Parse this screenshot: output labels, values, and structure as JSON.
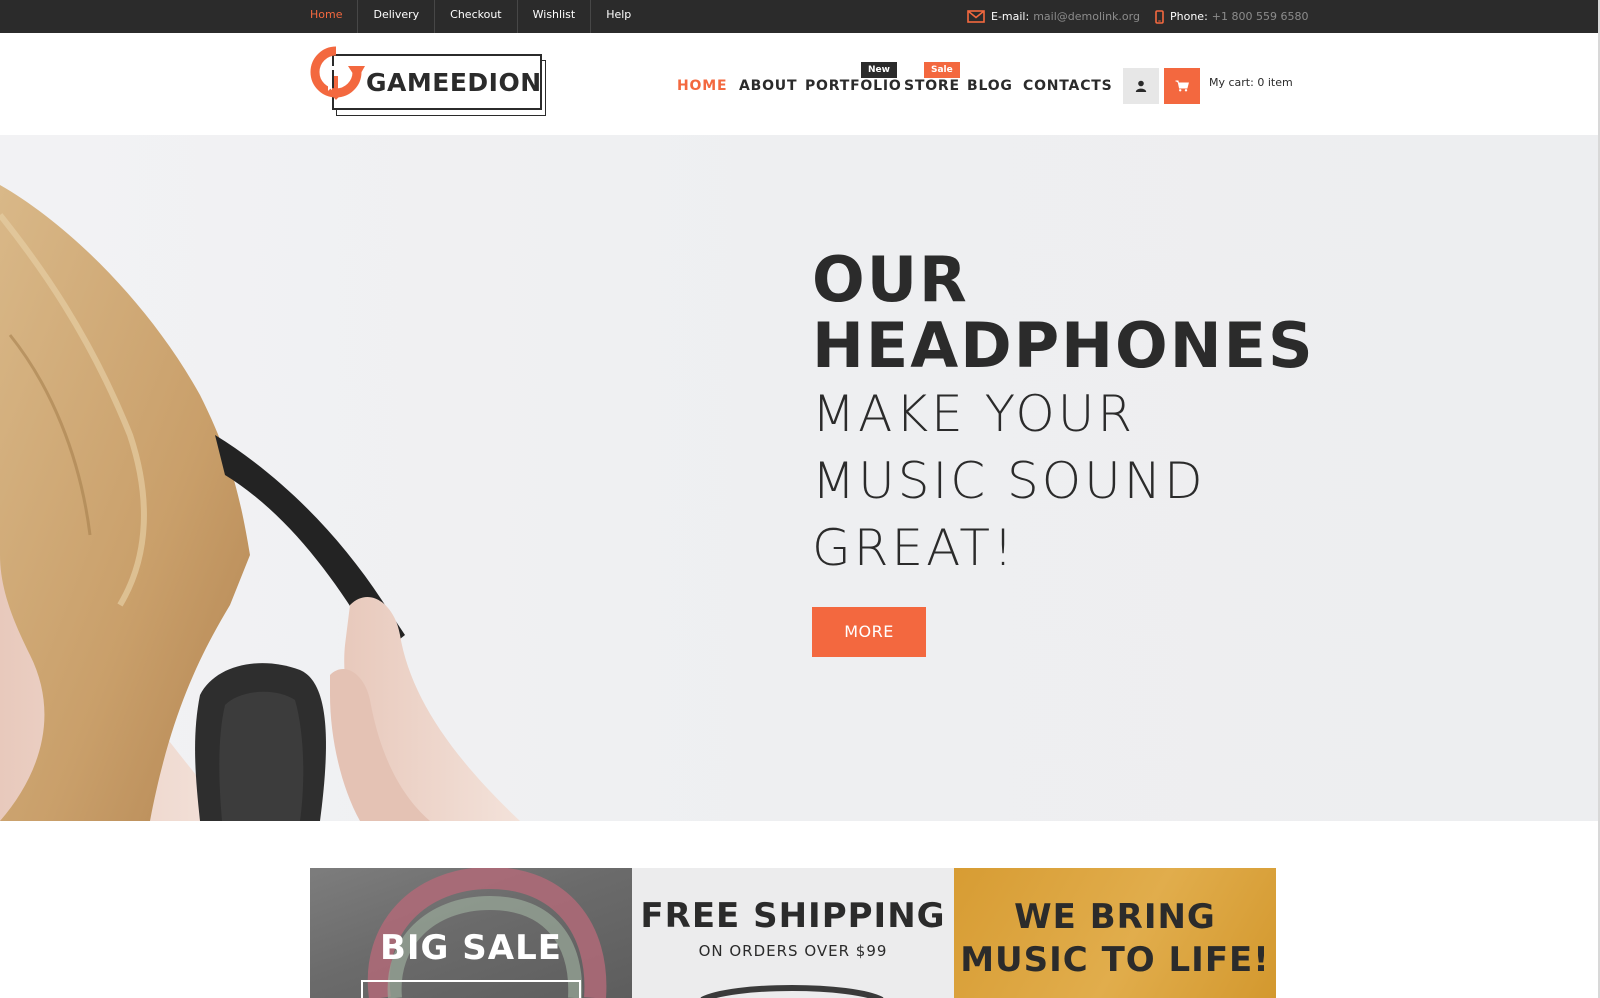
{
  "topbar": {
    "links": [
      "Home",
      "Delivery",
      "Checkout",
      "Wishlist",
      "Help"
    ],
    "email_label": "E-mail:",
    "email_value": "mail@demolink.org",
    "phone_label": "Phone:",
    "phone_value": "+1 800 559 6580"
  },
  "logo": {
    "text": "GAMEEDION"
  },
  "nav": {
    "items": [
      "HOME",
      "ABOUT",
      "PORTFOLIO",
      "STORE",
      "BLOG",
      "CONTACTS"
    ],
    "badge_new": "New",
    "badge_sale": "Sale"
  },
  "cart": {
    "label": "My cart:  0  item"
  },
  "hero": {
    "title_line1": "OUR",
    "title_line2": "HEADPHONES",
    "sub_line1": "MAKE YOUR",
    "sub_line2": "MUSIC SOUND",
    "sub_line3": "GREAT!",
    "button": "MORE"
  },
  "promos": {
    "big_sale": "BIG SALE",
    "free_shipping": "FREE SHIPPING",
    "free_shipping_sub": "ON ORDERS OVER $99",
    "bring_line1": "WE BRING",
    "bring_line2": "MUSIC TO LIFE!"
  },
  "colors": {
    "accent": "#f3683f",
    "dark": "#2b2b2b",
    "hero_bg": "#eeeff1",
    "gold": "#dba540"
  }
}
